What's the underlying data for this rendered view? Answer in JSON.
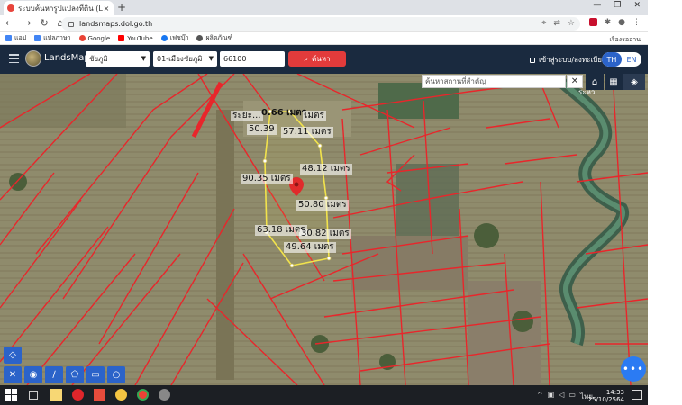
{
  "browser": {
    "tab_title": "ระบบค้นหารูปแปลงที่ดิน (LandsMaps)",
    "tab_close": "×",
    "new_tab": "+",
    "url": "landsmaps.dol.go.th",
    "window_controls": [
      "—",
      "❐",
      "✕"
    ],
    "nav": [
      "←",
      "→",
      "↻",
      "⌂"
    ]
  },
  "bookmarks": {
    "items": [
      {
        "label": "แอป",
        "color": "#4285f4"
      },
      {
        "label": "แปลภาษา",
        "color": "#4285f4"
      },
      {
        "label": "Google",
        "color": "#ea4335"
      },
      {
        "label": "YouTube",
        "color": "#ff0000"
      },
      {
        "label": "เฟซบุ๊ก",
        "color": "#1877f2"
      },
      {
        "label": "ผลิตภัณฑ์",
        "color": "#555555"
      }
    ],
    "right_label": "เรื่องรออ่าน"
  },
  "app": {
    "brand": "LandsMaps",
    "province": "ชัยภูมิ",
    "district": "01-เมืองชัยภูมิ",
    "postal": "66100",
    "search_label": "ค้นหา",
    "login_label": "เข้าสู่ระบบ/ลงทะเบียน",
    "lang_th": "TH",
    "lang_en": "EN"
  },
  "map": {
    "place_placeholder": "ค้นหาสถานที่สำคัญ",
    "clear": "✕",
    "river_label": "ระหว",
    "labels": {
      "top1": "ระยะ...",
      "top2": "0.66 เมตร",
      "top3": "เมตร",
      "l1": "50.39",
      "l2": "57.11 เมตร",
      "l3": "48.12 เมตร",
      "l4": "90.35 เมตร",
      "l5": "50.80 เมตร",
      "l6": "63.18 เมตร",
      "l7": "30.82 เมตร",
      "l8": "49.64 เมตร"
    },
    "fab": "•••",
    "colors": {
      "parcel": "#e8262b",
      "highlight": "#f2e34c",
      "pin": "#e02b2b"
    }
  },
  "taskbar": {
    "time": "14:33",
    "date": "25/10/2564",
    "lang": "ไทย"
  }
}
